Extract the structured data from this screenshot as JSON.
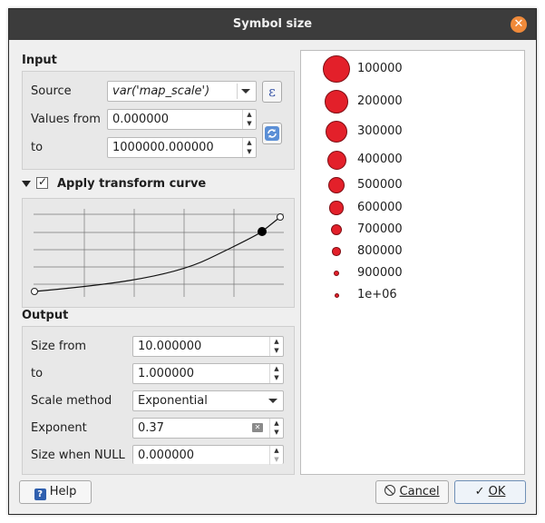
{
  "dialog": {
    "title": "Symbol size"
  },
  "input": {
    "title": "Input",
    "source_label": "Source",
    "source_value": "var('map_scale')",
    "values_from_label": "Values from",
    "values_from_value": "0.000000",
    "to_label": "to",
    "to_value": "1000000.000000"
  },
  "transform": {
    "label": "Apply transform curve",
    "checked": true
  },
  "output": {
    "title": "Output",
    "size_from_label": "Size from",
    "size_from_value": "10.000000",
    "to_label": "to",
    "to_value": "1.000000",
    "scale_method_label": "Scale method",
    "scale_method_value": "Exponential",
    "exponent_label": "Exponent",
    "exponent_value": "0.37",
    "size_null_label": "Size when NULL",
    "size_null_value": "0.000000"
  },
  "legend": {
    "items": [
      {
        "label": "100000",
        "size": 10.0
      },
      {
        "label": "200000",
        "size": 8.9
      },
      {
        "label": "300000",
        "size": 8.0
      },
      {
        "label": "400000",
        "size": 7.0
      },
      {
        "label": "500000",
        "size": 6.0
      },
      {
        "label": "600000",
        "size": 5.1
      },
      {
        "label": "700000",
        "size": 4.2
      },
      {
        "label": "800000",
        "size": 3.2
      },
      {
        "label": "900000",
        "size": 2.2
      },
      {
        "label": "1e+06",
        "size": 1.0
      }
    ]
  },
  "buttons": {
    "help": "Help",
    "cancel": "Cancel",
    "ok": "OK"
  },
  "icons": {
    "expression": "epsilon-icon",
    "refresh": "refresh-icon",
    "collapse": "triangle-down-icon",
    "help": "question-icon",
    "cancel": "cancel-circle-icon",
    "ok": "checkmark-icon",
    "clear": "clear-text-icon",
    "close": "close-icon"
  },
  "colors": {
    "symbol_fill": "#e3202a",
    "symbol_stroke": "#7d0d13",
    "titlebar": "#3c3c3c",
    "close_button": "#f08a3a"
  }
}
